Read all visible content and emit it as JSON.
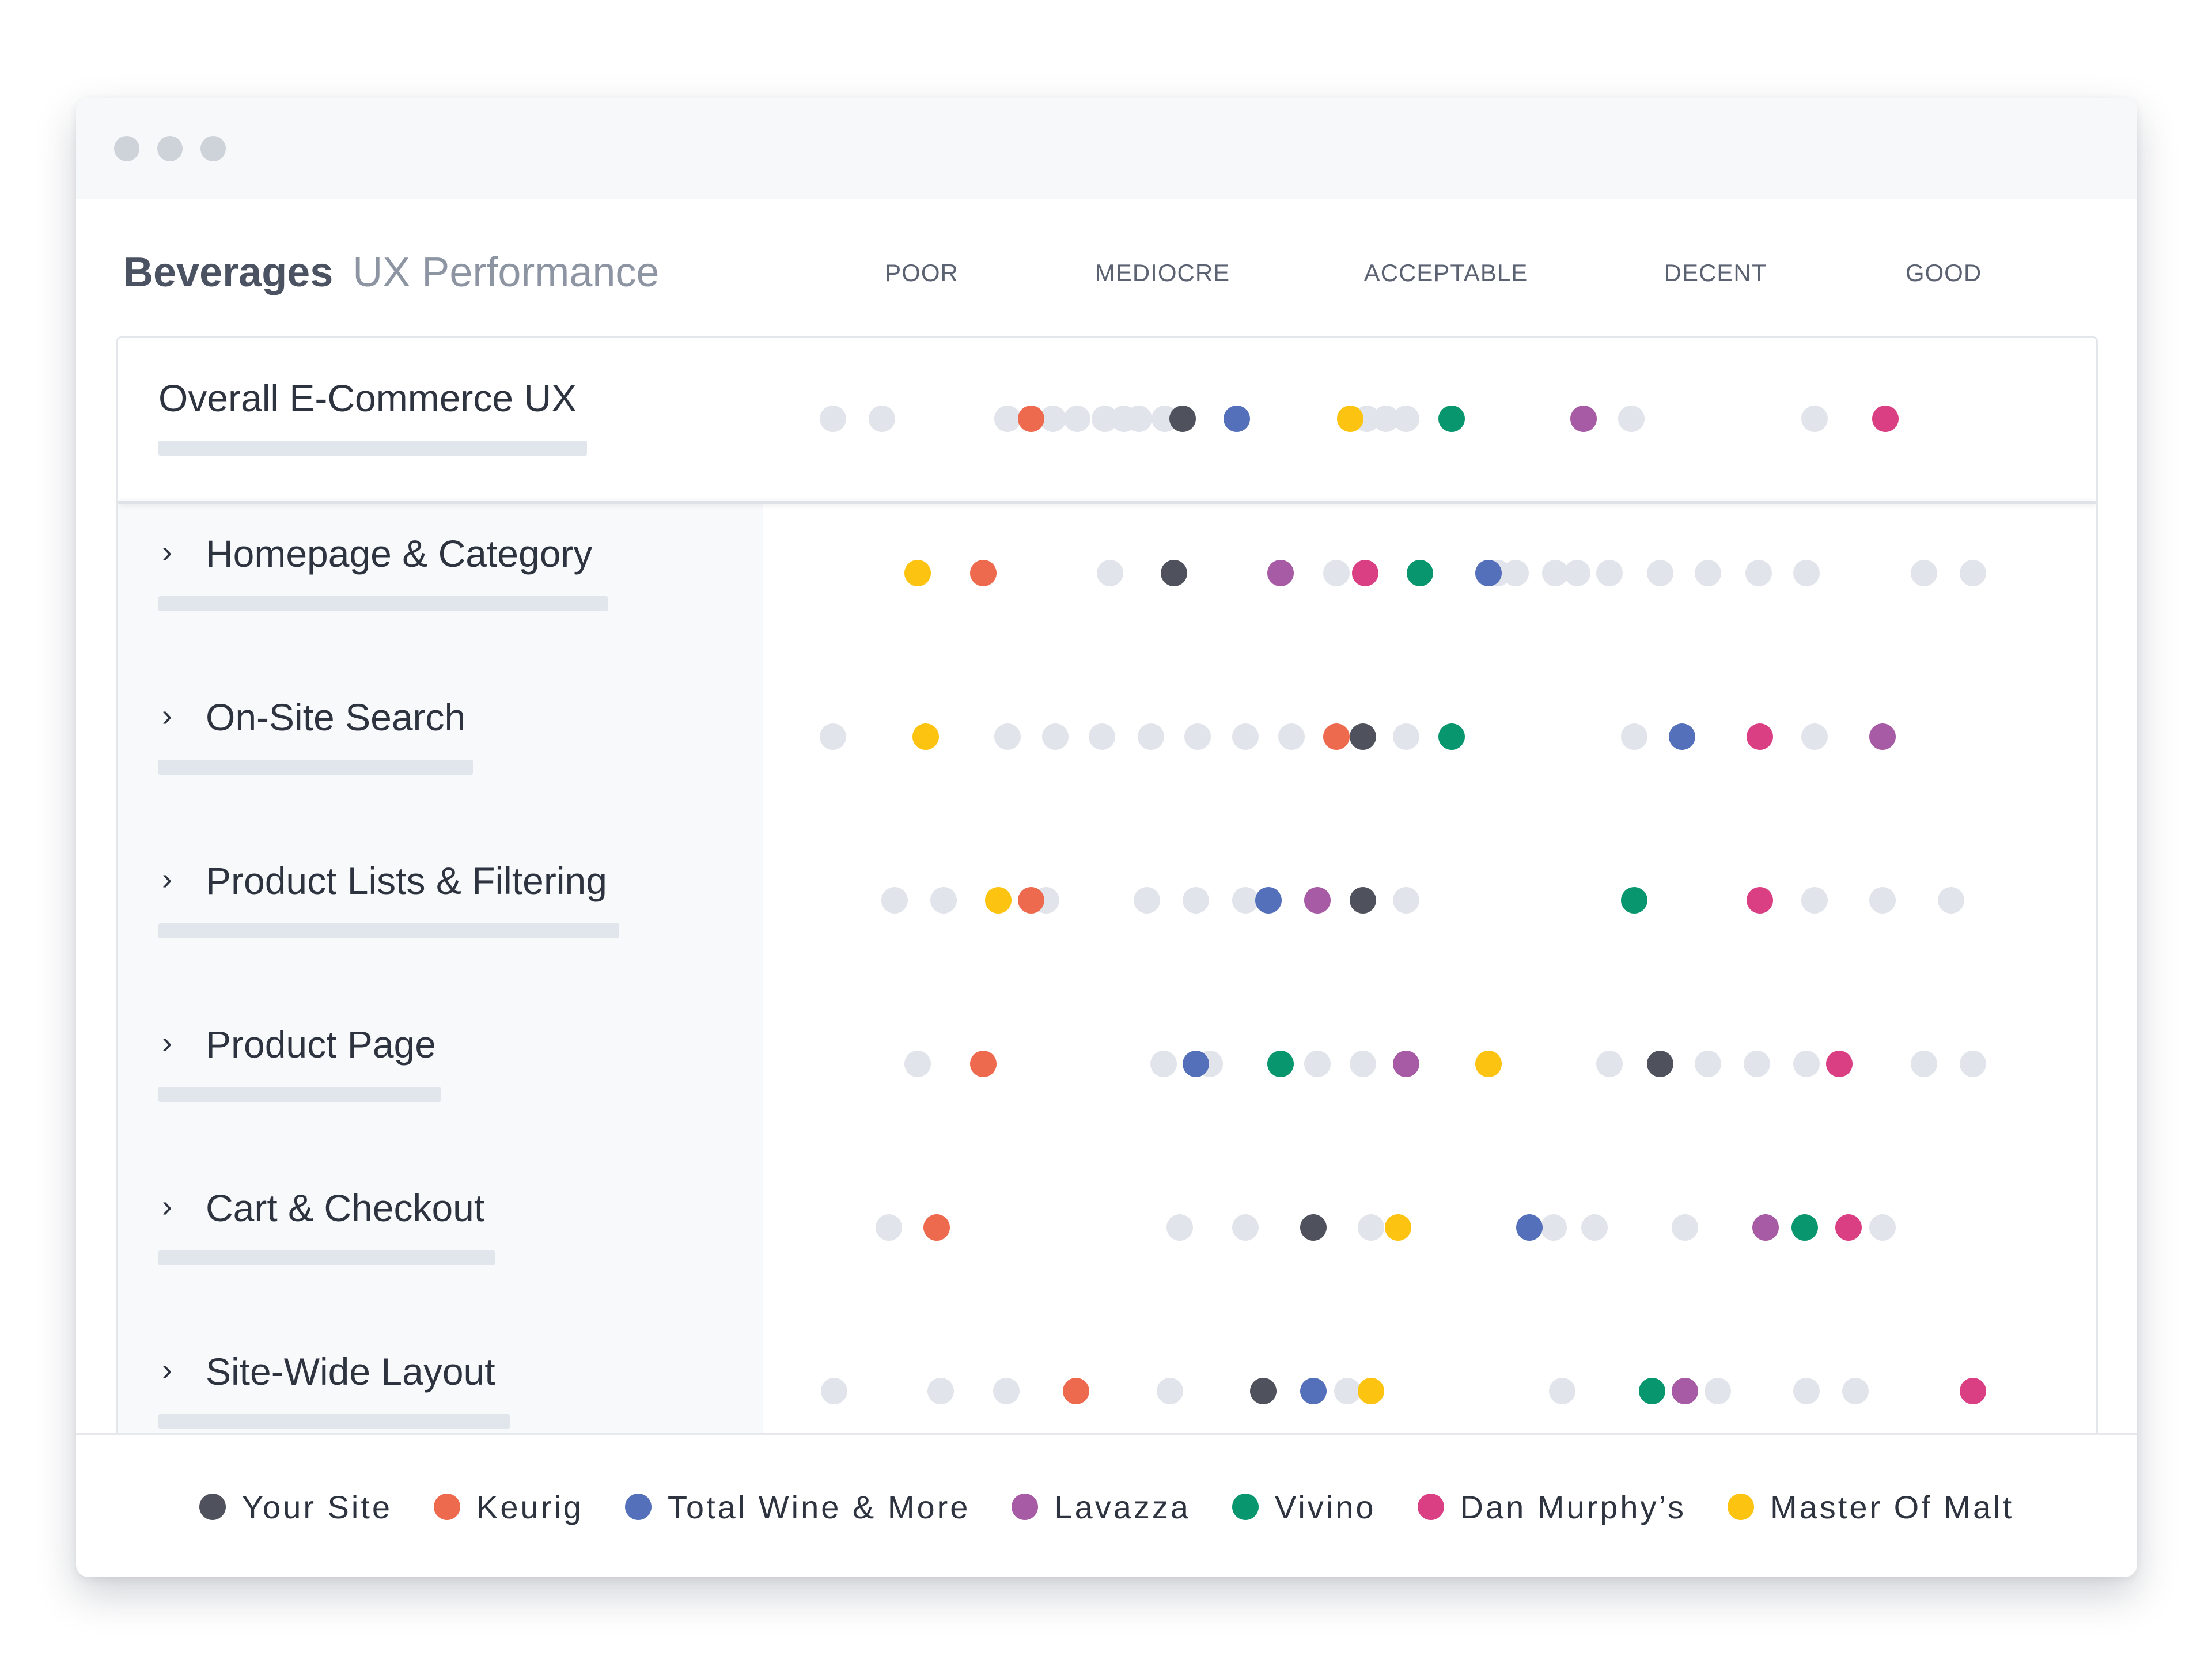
{
  "window": {
    "controls": [
      "close",
      "minimize",
      "maximize"
    ]
  },
  "header": {
    "title": "Beverages",
    "subtitle": "UX Performance"
  },
  "columns": [
    "POOR",
    "MEDIOCRE",
    "ACCEPTABLE",
    "DECENT",
    "GOOD"
  ],
  "colors": {
    "your_site": "#4f525c",
    "keurig": "#ee6a4e",
    "total_wine": "#5470bb",
    "lavazza": "#a65ba4",
    "vivino": "#07966e",
    "dan_murphys": "#db3f83",
    "master_of_malt": "#fcc310",
    "benchmark": "#e1e4ea"
  },
  "chart_data": {
    "type": "scatter",
    "x_scale": [
      "POOR",
      "MEDIOCRE",
      "ACCEPTABLE",
      "DECENT",
      "GOOD"
    ],
    "rows": [
      {
        "label": "Overall E-Commerce UX",
        "grey": [
          0.08,
          0.44,
          1.36,
          1.69,
          1.87,
          2.07,
          2.21,
          2.32,
          2.51,
          3.99,
          4.13,
          4.28,
          5.93,
          7.27
        ],
        "points": [
          {
            "site": "your_site",
            "pos": 2.64
          },
          {
            "site": "keurig",
            "pos": 1.53
          },
          {
            "site": "total_wine",
            "pos": 3.04
          },
          {
            "site": "lavazza",
            "pos": 5.58
          },
          {
            "site": "vivino",
            "pos": 4.61
          },
          {
            "site": "dan_murphys",
            "pos": 7.79
          },
          {
            "site": "master_of_malt",
            "pos": 3.87
          }
        ]
      },
      {
        "label": "Homepage & Category",
        "grey": [
          2.11,
          3.77,
          4.95,
          5.08,
          5.37,
          5.53,
          5.77,
          6.14,
          6.49,
          6.86,
          7.21,
          8.07,
          8.43
        ],
        "points": [
          {
            "site": "your_site",
            "pos": 2.58
          },
          {
            "site": "keurig",
            "pos": 1.18
          },
          {
            "site": "total_wine",
            "pos": 4.88
          },
          {
            "site": "lavazza",
            "pos": 3.36
          },
          {
            "site": "vivino",
            "pos": 4.38
          },
          {
            "site": "dan_murphys",
            "pos": 3.98
          },
          {
            "site": "master_of_malt",
            "pos": 0.7
          }
        ]
      },
      {
        "label": "On-Site Search",
        "grey": [
          0.08,
          1.36,
          1.71,
          2.05,
          2.41,
          2.75,
          3.1,
          3.44,
          4.28,
          5.95,
          7.27
        ],
        "points": [
          {
            "site": "your_site",
            "pos": 3.96
          },
          {
            "site": "keurig",
            "pos": 3.77
          },
          {
            "site": "total_wine",
            "pos": 6.3
          },
          {
            "site": "lavazza",
            "pos": 7.77
          },
          {
            "site": "vivino",
            "pos": 4.61
          },
          {
            "site": "dan_murphys",
            "pos": 6.87
          },
          {
            "site": "master_of_malt",
            "pos": 0.76
          }
        ]
      },
      {
        "label": "Product Lists & Filtering",
        "grey": [
          0.53,
          0.89,
          1.64,
          2.38,
          2.74,
          3.1,
          4.28,
          7.27,
          7.77,
          8.27
        ],
        "points": [
          {
            "site": "your_site",
            "pos": 3.96
          },
          {
            "site": "keurig",
            "pos": 1.53
          },
          {
            "site": "total_wine",
            "pos": 3.27
          },
          {
            "site": "lavazza",
            "pos": 3.63
          },
          {
            "site": "vivino",
            "pos": 5.95
          },
          {
            "site": "dan_murphys",
            "pos": 6.87
          },
          {
            "site": "master_of_malt",
            "pos": 1.29
          }
        ]
      },
      {
        "label": "Product Page",
        "grey": [
          0.7,
          2.5,
          2.84,
          3.63,
          3.96,
          5.77,
          6.49,
          6.85,
          7.21,
          8.07,
          8.43
        ],
        "points": [
          {
            "site": "your_site",
            "pos": 6.14
          },
          {
            "site": "keurig",
            "pos": 1.18
          },
          {
            "site": "total_wine",
            "pos": 2.74
          },
          {
            "site": "lavazza",
            "pos": 4.28
          },
          {
            "site": "vivino",
            "pos": 3.36
          },
          {
            "site": "dan_murphys",
            "pos": 7.45
          },
          {
            "site": "master_of_malt",
            "pos": 4.88
          }
        ]
      },
      {
        "label": "Cart & Checkout",
        "grey": [
          0.49,
          2.62,
          3.1,
          4.02,
          5.36,
          5.66,
          6.32,
          7.77
        ],
        "points": [
          {
            "site": "your_site",
            "pos": 3.6
          },
          {
            "site": "keurig",
            "pos": 0.84
          },
          {
            "site": "total_wine",
            "pos": 5.18
          },
          {
            "site": "lavazza",
            "pos": 6.91
          },
          {
            "site": "vivino",
            "pos": 7.2
          },
          {
            "site": "dan_murphys",
            "pos": 7.52
          },
          {
            "site": "master_of_malt",
            "pos": 4.22
          }
        ]
      },
      {
        "label": "Site-Wide Layout",
        "grey": [
          0.09,
          0.87,
          1.35,
          2.55,
          3.23,
          3.85,
          5.42,
          6.56,
          7.21,
          7.57
        ],
        "points": [
          {
            "site": "your_site",
            "pos": 3.23
          },
          {
            "site": "keurig",
            "pos": 1.86
          },
          {
            "site": "total_wine",
            "pos": 3.6
          },
          {
            "site": "lavazza",
            "pos": 6.32
          },
          {
            "site": "vivino",
            "pos": 6.08
          },
          {
            "site": "dan_murphys",
            "pos": 8.43
          },
          {
            "site": "master_of_malt",
            "pos": 4.02
          }
        ]
      }
    ]
  },
  "legend": [
    {
      "key": "your_site",
      "label": "Your Site"
    },
    {
      "key": "keurig",
      "label": "Keurig"
    },
    {
      "key": "total_wine",
      "label": "Total Wine & More"
    },
    {
      "key": "lavazza",
      "label": "Lavazza"
    },
    {
      "key": "vivino",
      "label": "Vivino"
    },
    {
      "key": "dan_murphys",
      "label": "Dan Murphy’s"
    },
    {
      "key": "master_of_malt",
      "label": "Master Of Malt"
    }
  ]
}
